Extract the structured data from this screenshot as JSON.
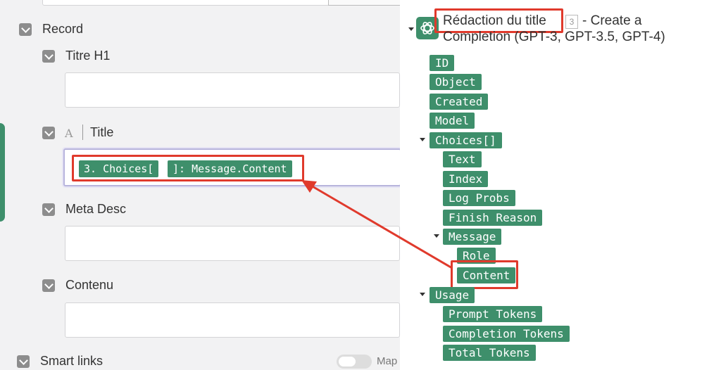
{
  "colors": {
    "accent": "#3e8f6b",
    "highlight": "#e03a2c",
    "focus": "#b7b4dc"
  },
  "left_panel": {
    "record_label": "Record",
    "fields": [
      {
        "label": "Titre H1",
        "value": ""
      },
      {
        "label": "Title",
        "type_icon": "A",
        "pills": [
          "3. Choices[",
          "]: Message.Content"
        ]
      },
      {
        "label": "Meta Desc",
        "value": ""
      },
      {
        "label": "Contenu",
        "value": ""
      }
    ],
    "smart_links_label": "Smart links",
    "map_label": "Map"
  },
  "right_panel": {
    "module_title": "Rédaction du title",
    "module_badge": "3",
    "module_subtitle_line1": "- Create a",
    "module_subtitle_line2": "Completion (GPT-3, GPT-3.5, GPT-4)",
    "tree": {
      "id": "ID",
      "object": "Object",
      "created": "Created",
      "model": "Model",
      "choices": "Choices[]",
      "text": "Text",
      "index": "Index",
      "log_probs": "Log Probs",
      "finish_reason": "Finish Reason",
      "message": "Message",
      "role": "Role",
      "content": "Content",
      "usage": "Usage",
      "prompt_tokens": "Prompt Tokens",
      "completion_tokens": "Completion Tokens",
      "total_tokens": "Total Tokens"
    }
  }
}
